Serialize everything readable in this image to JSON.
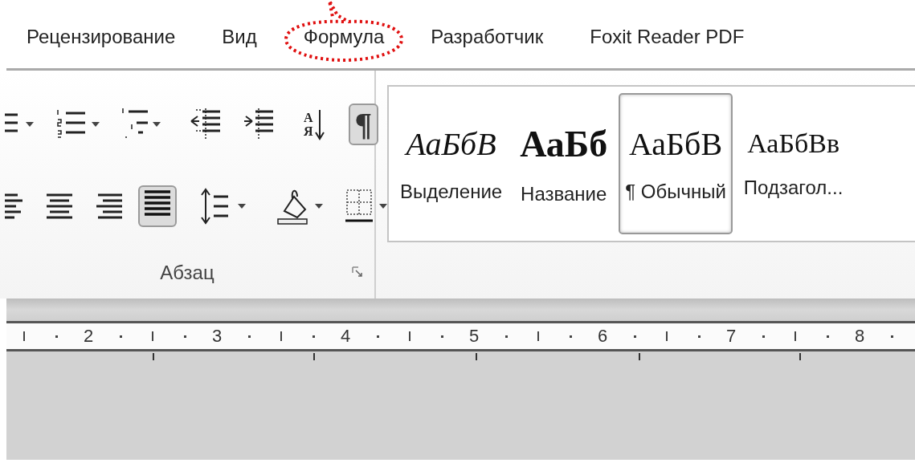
{
  "tabs": [
    {
      "label": "Рецензирование",
      "circled": false
    },
    {
      "label": "Вид",
      "circled": false
    },
    {
      "label": "Формула",
      "circled": true
    },
    {
      "label": "Разработчик",
      "circled": false
    },
    {
      "label": "Foxit Reader PDF",
      "circled": false
    }
  ],
  "paragraph_group": {
    "label": "Абзац",
    "rows": [
      {
        "groups": [
          {
            "buttons": [
              {
                "kind": "bullets",
                "on": false,
                "dropdown": true
              },
              {
                "kind": "numbering",
                "on": false,
                "dropdown": true
              },
              {
                "kind": "multilevel",
                "on": false,
                "dropdown": true
              }
            ]
          },
          {
            "buttons": [
              {
                "kind": "decrease-indent",
                "on": false,
                "dropdown": false
              },
              {
                "kind": "increase-indent",
                "on": false,
                "dropdown": false
              }
            ]
          },
          {
            "buttons": [
              {
                "kind": "sort",
                "on": false,
                "dropdown": false,
                "letters": [
                  "А",
                  "Я"
                ]
              }
            ]
          },
          {
            "buttons": [
              {
                "kind": "pilcrow",
                "on": true,
                "dropdown": false,
                "glyph": "¶"
              }
            ]
          }
        ]
      },
      {
        "groups": [
          {
            "buttons": [
              {
                "kind": "align-left",
                "on": false,
                "dropdown": false
              },
              {
                "kind": "align-center",
                "on": false,
                "dropdown": false
              },
              {
                "kind": "align-right",
                "on": false,
                "dropdown": false
              },
              {
                "kind": "justify",
                "on": true,
                "dropdown": false
              }
            ]
          },
          {
            "buttons": [
              {
                "kind": "line-spacing",
                "on": false,
                "dropdown": true
              }
            ]
          },
          {
            "buttons": [
              {
                "kind": "shading",
                "on": false,
                "dropdown": true
              },
              {
                "kind": "borders",
                "on": false,
                "dropdown": true
              }
            ]
          }
        ]
      }
    ]
  },
  "styles": [
    {
      "kind": "emphasis",
      "preview": "АаБбВ",
      "name": "Выделение",
      "selected": false
    },
    {
      "kind": "title",
      "preview": "АаБб",
      "name": "Название",
      "selected": false
    },
    {
      "kind": "normal",
      "preview": "АаБбВ",
      "name": "¶ Обычный",
      "selected": true
    },
    {
      "kind": "subtitle",
      "preview": "АаБбВв",
      "name": "Подзагол...",
      "selected": false
    }
  ],
  "ruler": {
    "labels": [
      "2",
      "3",
      "4",
      "5",
      "6",
      "7",
      "8"
    ]
  }
}
